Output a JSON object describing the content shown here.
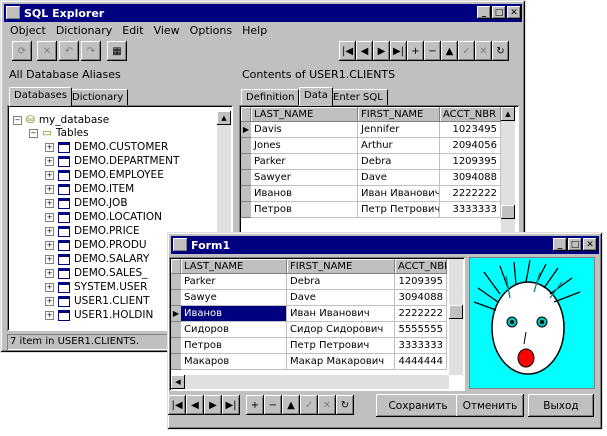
{
  "explorer": {
    "title": "SQL Explorer",
    "menu": [
      "Object",
      "Dictionary",
      "Edit",
      "View",
      "Options",
      "Help"
    ],
    "left_header": "All Database Aliases",
    "left_tabs": [
      "Databases",
      "Dictionary"
    ],
    "tree": {
      "root": "my_database",
      "folder": "Tables",
      "items": [
        "DEMO.CUSTOMER",
        "DEMO.DEPARTMENT",
        "DEMO.EMPLOYEE",
        "DEMO.ITEM",
        "DEMO.JOB",
        "DEMO.LOCATION",
        "DEMO.PRICE",
        "DEMO.PRODU",
        "DEMO.SALARY",
        "DEMO.SALES_",
        "SYSTEM.USER",
        "USER1.CLIENT",
        "USER1.HOLDIN"
      ]
    },
    "right_header": "Contents of USER1.CLIENTS",
    "right_tabs": [
      "Definition",
      "Data",
      "Enter SQL"
    ],
    "grid": {
      "columns": [
        "LAST_NAME",
        "FIRST_NAME",
        "ACCT_NBR"
      ],
      "rows": [
        [
          "Davis",
          "Jennifer",
          "1023495"
        ],
        [
          "Jones",
          "Arthur",
          "2094056"
        ],
        [
          "Parker",
          "Debra",
          "1209395"
        ],
        [
          "Sawyer",
          "Dave",
          "3094088"
        ],
        [
          "Иванов",
          "Иван Иванович",
          "2222222"
        ],
        [
          "Петров",
          "Петр Петрович",
          "3333333"
        ]
      ]
    },
    "status": "7 item in USER1.CLIENTS."
  },
  "form1": {
    "title": "Form1",
    "grid": {
      "columns": [
        "LAST_NAME",
        "FIRST_NAME",
        "ACCT_NBR"
      ],
      "rows": [
        [
          "Parker",
          "Debra",
          "1209395"
        ],
        [
          "Sawye",
          "Dave",
          "3094088"
        ],
        [
          "Иванов",
          "Иван Иванович",
          "2222222"
        ],
        [
          "Сидоров",
          "Сидор Сидорович",
          "5555555"
        ],
        [
          "Петров",
          "Петр Петрович",
          "3333333"
        ],
        [
          "Макаров",
          "Макар Макарович",
          "4444444"
        ]
      ]
    },
    "buttons": {
      "save": "Сохранить",
      "cancel": "Отменить",
      "exit": "Выход"
    }
  },
  "colors": {
    "titlebar": "#000080",
    "face_bg": "#00ffff",
    "selection": "#000080"
  }
}
